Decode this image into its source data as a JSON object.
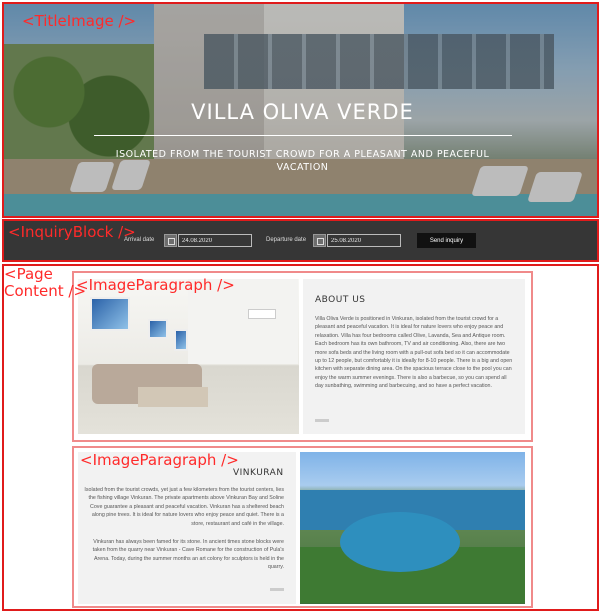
{
  "annotations": {
    "title_image": "<TitleImage />",
    "inquiry_block": "<InquiryBlock />",
    "page_content": "<Page\nContent />",
    "image_paragraph_1": "<ImageParagraph />",
    "image_paragraph_2": "<ImageParagraph />"
  },
  "hero": {
    "title": "VILLA OLIVA VERDE",
    "subtitle": "ISOLATED FROM THE TOURIST CROWD FOR A PLEASANT AND PEACEFUL VACATION"
  },
  "inquiry": {
    "arrival_label": "Arrival date",
    "arrival_value": "24.08.2020",
    "departure_label": "Departure date",
    "departure_value": "25.08.2020",
    "send_label": "Send inquiry",
    "calendar_icon": "calendar-icon"
  },
  "about": {
    "title": "ABOUT US",
    "body": "Villa Oliva Verde is positioned in Vinkuran, isolated from the tourist crowd for a pleasant and peaceful vacation. It is ideal for nature lovers who enjoy peace and relaxation. Villa has four bedrooms called Olive, Lavanda, Sea and Antique room. Each bedroom has its own bathroom, TV and air conditioning. Also, there are two more sofa beds and the living room with a pull-out sofa bed so it can accommodate up to 12 people, but comfortably it is ideally for 8-10 people. There is a big and open kitchen with separate dining area. On the spacious terrace close to the pool you can enjoy the warm summer evenings. There is also a barbecue, so you can spend all day sunbathing, swimming and barbecuing, and so have a perfect vacation."
  },
  "vinkuran": {
    "title": "VINKURAN",
    "body_1": "Isolated from the tourist crowds, yet just a few kilometers from the tourist centers, lies the fishing village Vinkuran. The private apartments above Vinkuran Bay and Soline Cove guarantee a pleasant and peaceful vacation. Vinkuran has a sheltered beach along pine trees. It is ideal for nature lovers who enjoy peace and quiet. There is a store, restaurant and café in the village.",
    "body_2": "Vinkuran has always been famed for its stone. In ancient times stone blocks were taken from the quarry near Vinkuran - Cave Romane for the construction of Pula's Arena. Today, during the summer months an art colony for sculptors is held in the quarry."
  }
}
